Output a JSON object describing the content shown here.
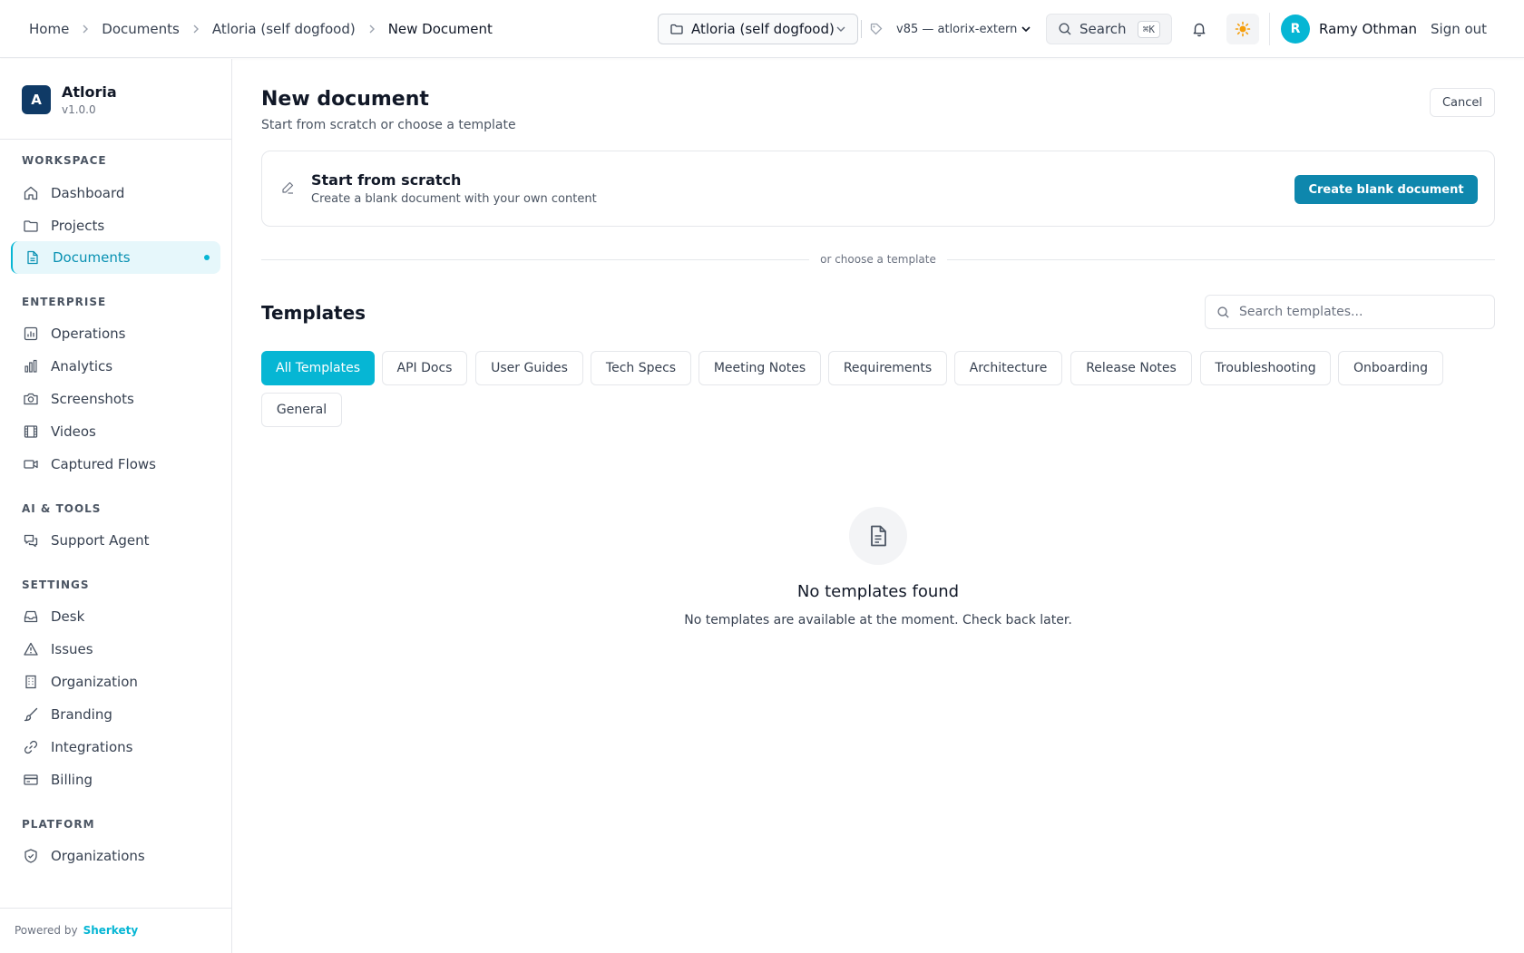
{
  "breadcrumb": [
    "Home",
    "Documents",
    "Atloria (self dogfood)",
    "New Document"
  ],
  "header": {
    "project_select": "Atloria (self dogfood)",
    "version_select": "v85 — atlorix-extern",
    "search_label": "Search",
    "search_shortcut": "⌘K",
    "user_initial": "R",
    "user_name": "Ramy Othman",
    "sign_out": "Sign out"
  },
  "sidebar": {
    "brand_initial": "A",
    "brand_name": "Atloria",
    "brand_version": "v1.0.0",
    "sections": {
      "workspace": "WORKSPACE",
      "enterprise": "ENTERPRISE",
      "ai_tools": "AI & TOOLS",
      "settings": "SETTINGS",
      "platform": "PLATFORM"
    },
    "items": {
      "dashboard": "Dashboard",
      "projects": "Projects",
      "documents": "Documents",
      "operations": "Operations",
      "analytics": "Analytics",
      "screenshots": "Screenshots",
      "videos": "Videos",
      "captured_flows": "Captured Flows",
      "support_agent": "Support Agent",
      "desk": "Desk",
      "issues": "Issues",
      "organization": "Organization",
      "branding": "Branding",
      "integrations": "Integrations",
      "billing": "Billing",
      "organizations": "Organizations"
    },
    "active_item": "Documents",
    "powered_by": "Powered by",
    "powered_brand": "Sherkety"
  },
  "main": {
    "title": "New document",
    "subtitle": "Start from scratch or choose a template",
    "cancel": "Cancel",
    "scratch": {
      "title": "Start from scratch",
      "subtitle": "Create a blank document with your own content",
      "button": "Create blank document"
    },
    "divider_text": "or choose a template",
    "templates_title": "Templates",
    "templates_search_placeholder": "Search templates...",
    "categories": [
      "All Templates",
      "API Docs",
      "User Guides",
      "Tech Specs",
      "Meeting Notes",
      "Requirements",
      "Architecture",
      "Release Notes",
      "Troubleshooting",
      "Onboarding",
      "General"
    ],
    "active_category": "All Templates",
    "empty_title": "No templates found",
    "empty_subtitle": "No templates are available at the moment. Check back later."
  },
  "colors": {
    "accent": "#06b6d4",
    "primary_button": "#0e87ad",
    "brand_logo": "#0f3a66",
    "theme_icon": "#f59e0b"
  }
}
